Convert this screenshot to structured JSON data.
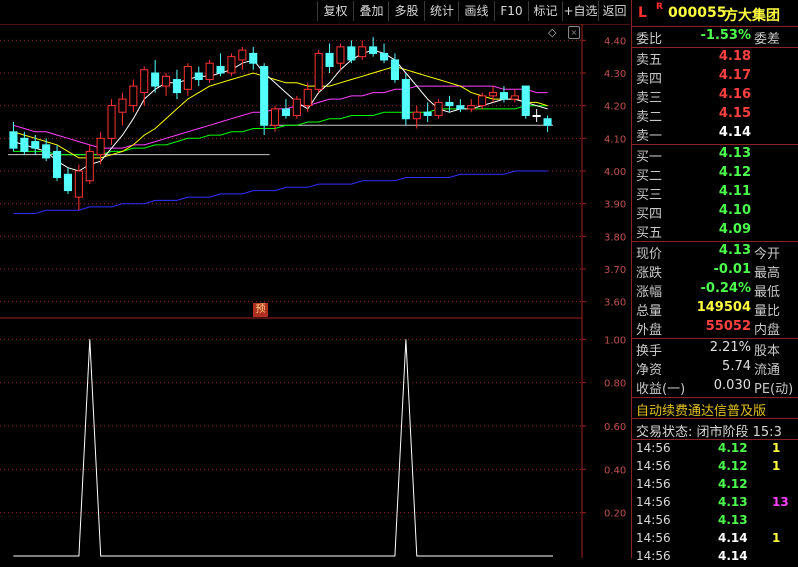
{
  "toolbar": [
    {
      "label": "复权"
    },
    {
      "label": "叠加"
    },
    {
      "label": "多股"
    },
    {
      "label": "统计"
    },
    {
      "label": "画线"
    },
    {
      "label": "F10"
    },
    {
      "label": "标记"
    },
    {
      "label": "+自选"
    },
    {
      "label": "返回"
    }
  ],
  "main_axis": [
    "4.40",
    "4.30",
    "4.20",
    "4.10",
    "4.00",
    "3.90",
    "3.80",
    "3.70",
    "3.60"
  ],
  "indicator_axis": [
    "1.00",
    "0.80",
    "0.60",
    "0.40",
    "0.20"
  ],
  "pre_badge": "预",
  "colors": {
    "up": "#ff3333",
    "down": "#54ffff",
    "flat": "#ffffff",
    "ma5": "#ffffff",
    "ma10": "#ffff00",
    "ma20": "#ff40ff",
    "ma60": "#00ff00",
    "ma120": "#3030ff",
    "line_flat": "#c8c8c8"
  },
  "chart_data": {
    "type": "candlestick",
    "ylim": [
      3.55,
      4.45
    ],
    "candles": [
      {
        "o": 4.12,
        "h": 4.15,
        "l": 4.06,
        "c": 4.07
      },
      {
        "o": 4.1,
        "h": 4.12,
        "l": 4.05,
        "c": 4.06
      },
      {
        "o": 4.09,
        "h": 4.11,
        "l": 4.05,
        "c": 4.07
      },
      {
        "o": 4.08,
        "h": 4.1,
        "l": 4.03,
        "c": 4.04
      },
      {
        "o": 4.06,
        "h": 4.08,
        "l": 3.97,
        "c": 3.98
      },
      {
        "o": 3.99,
        "h": 4.01,
        "l": 3.93,
        "c": 3.94
      },
      {
        "o": 3.92,
        "h": 4.02,
        "l": 3.88,
        "c": 4.0
      },
      {
        "o": 3.97,
        "h": 4.08,
        "l": 3.96,
        "c": 4.06
      },
      {
        "o": 4.05,
        "h": 4.12,
        "l": 4.02,
        "c": 4.1
      },
      {
        "o": 4.1,
        "h": 4.22,
        "l": 4.08,
        "c": 4.2
      },
      {
        "o": 4.18,
        "h": 4.24,
        "l": 4.14,
        "c": 4.22
      },
      {
        "o": 4.2,
        "h": 4.28,
        "l": 4.18,
        "c": 4.26
      },
      {
        "o": 4.24,
        "h": 4.32,
        "l": 4.2,
        "c": 4.31
      },
      {
        "o": 4.3,
        "h": 4.34,
        "l": 4.24,
        "c": 4.26
      },
      {
        "o": 4.26,
        "h": 4.3,
        "l": 4.23,
        "c": 4.29
      },
      {
        "o": 4.28,
        "h": 4.31,
        "l": 4.22,
        "c": 4.24
      },
      {
        "o": 4.25,
        "h": 4.33,
        "l": 4.23,
        "c": 4.32
      },
      {
        "o": 4.3,
        "h": 4.32,
        "l": 4.26,
        "c": 4.28
      },
      {
        "o": 4.28,
        "h": 4.34,
        "l": 4.27,
        "c": 4.33
      },
      {
        "o": 4.32,
        "h": 4.36,
        "l": 4.29,
        "c": 4.3
      },
      {
        "o": 4.3,
        "h": 4.36,
        "l": 4.29,
        "c": 4.35
      },
      {
        "o": 4.34,
        "h": 4.38,
        "l": 4.31,
        "c": 4.37
      },
      {
        "o": 4.36,
        "h": 4.38,
        "l": 4.31,
        "c": 4.33
      },
      {
        "o": 4.32,
        "h": 4.33,
        "l": 4.11,
        "c": 4.14
      },
      {
        "o": 4.14,
        "h": 4.2,
        "l": 4.12,
        "c": 4.19
      },
      {
        "o": 4.19,
        "h": 4.22,
        "l": 4.16,
        "c": 4.17
      },
      {
        "o": 4.17,
        "h": 4.23,
        "l": 4.16,
        "c": 4.22
      },
      {
        "o": 4.2,
        "h": 4.27,
        "l": 4.18,
        "c": 4.25
      },
      {
        "o": 4.25,
        "h": 4.37,
        "l": 4.24,
        "c": 4.36
      },
      {
        "o": 4.36,
        "h": 4.39,
        "l": 4.3,
        "c": 4.32
      },
      {
        "o": 4.33,
        "h": 4.39,
        "l": 4.31,
        "c": 4.38
      },
      {
        "o": 4.38,
        "h": 4.4,
        "l": 4.33,
        "c": 4.34
      },
      {
        "o": 4.35,
        "h": 4.4,
        "l": 4.34,
        "c": 4.38
      },
      {
        "o": 4.38,
        "h": 4.41,
        "l": 4.35,
        "c": 4.36
      },
      {
        "o": 4.36,
        "h": 4.39,
        "l": 4.33,
        "c": 4.34
      },
      {
        "o": 4.34,
        "h": 4.36,
        "l": 4.27,
        "c": 4.28
      },
      {
        "o": 4.28,
        "h": 4.3,
        "l": 4.14,
        "c": 4.16
      },
      {
        "o": 4.16,
        "h": 4.2,
        "l": 4.13,
        "c": 4.18
      },
      {
        "o": 4.18,
        "h": 4.21,
        "l": 4.15,
        "c": 4.17
      },
      {
        "o": 4.17,
        "h": 4.22,
        "l": 4.16,
        "c": 4.21
      },
      {
        "o": 4.21,
        "h": 4.23,
        "l": 4.18,
        "c": 4.2
      },
      {
        "o": 4.2,
        "h": 4.22,
        "l": 4.18,
        "c": 4.19
      },
      {
        "o": 4.19,
        "h": 4.22,
        "l": 4.18,
        "c": 4.2
      },
      {
        "o": 4.2,
        "h": 4.24,
        "l": 4.19,
        "c": 4.23
      },
      {
        "o": 4.23,
        "h": 4.26,
        "l": 4.21,
        "c": 4.24
      },
      {
        "o": 4.24,
        "h": 4.26,
        "l": 4.21,
        "c": 4.22
      },
      {
        "o": 4.22,
        "h": 4.25,
        "l": 4.21,
        "c": 4.23
      },
      {
        "o": 4.26,
        "h": 4.26,
        "l": 4.16,
        "c": 4.17
      },
      {
        "o": 4.17,
        "h": 4.19,
        "l": 4.15,
        "c": 4.17
      },
      {
        "o": 4.16,
        "h": 4.17,
        "l": 4.12,
        "c": 4.14
      }
    ],
    "ma5": [
      4.09,
      4.08,
      4.07,
      4.06,
      4.03,
      4.01,
      4.0,
      4.02,
      4.03,
      4.07,
      4.11,
      4.16,
      4.22,
      4.25,
      4.27,
      4.27,
      4.28,
      4.29,
      4.29,
      4.3,
      4.31,
      4.33,
      4.34,
      4.3,
      4.27,
      4.24,
      4.21,
      4.19,
      4.24,
      4.27,
      4.31,
      4.34,
      4.36,
      4.37,
      4.36,
      4.34,
      4.3,
      4.26,
      4.22,
      4.19,
      4.18,
      4.19,
      4.19,
      4.2,
      4.21,
      4.22,
      4.22,
      4.21,
      4.2,
      4.19
    ],
    "ma10": [
      4.12,
      4.11,
      4.1,
      4.09,
      4.08,
      4.06,
      4.04,
      4.04,
      4.04,
      4.05,
      4.06,
      4.08,
      4.11,
      4.13,
      4.16,
      4.19,
      4.22,
      4.24,
      4.26,
      4.27,
      4.28,
      4.29,
      4.3,
      4.29,
      4.28,
      4.27,
      4.27,
      4.26,
      4.26,
      4.26,
      4.27,
      4.28,
      4.29,
      4.3,
      4.31,
      4.32,
      4.31,
      4.3,
      4.29,
      4.28,
      4.27,
      4.26,
      4.24,
      4.23,
      4.22,
      4.22,
      4.22,
      4.21,
      4.21,
      4.2
    ],
    "ma20": [
      4.14,
      4.13,
      4.12,
      4.12,
      4.11,
      4.1,
      4.09,
      4.08,
      4.07,
      4.07,
      4.07,
      4.08,
      4.08,
      4.09,
      4.1,
      4.11,
      4.12,
      4.13,
      4.14,
      4.15,
      4.16,
      4.17,
      4.18,
      4.18,
      4.19,
      4.19,
      4.2,
      4.2,
      4.21,
      4.22,
      4.22,
      4.23,
      4.23,
      4.24,
      4.24,
      4.25,
      4.25,
      4.26,
      4.26,
      4.26,
      4.26,
      4.26,
      4.26,
      4.26,
      4.26,
      4.25,
      4.25,
      4.25,
      4.24,
      4.24
    ],
    "ma60": [
      4.06,
      4.06,
      4.06,
      4.06,
      4.05,
      4.05,
      4.05,
      4.05,
      4.05,
      4.06,
      4.06,
      4.07,
      4.07,
      4.08,
      4.08,
      4.09,
      4.1,
      4.1,
      4.11,
      4.11,
      4.12,
      4.12,
      4.13,
      4.13,
      4.13,
      4.14,
      4.14,
      4.15,
      4.15,
      4.16,
      4.16,
      4.17,
      4.17,
      4.17,
      4.18,
      4.18,
      4.18,
      4.18,
      4.18,
      4.19,
      4.19,
      4.19,
      4.19,
      4.19,
      4.19,
      4.19,
      4.19,
      4.2,
      4.2,
      4.2
    ],
    "ma120": [
      3.87,
      3.87,
      3.87,
      3.88,
      3.88,
      3.88,
      3.88,
      3.89,
      3.89,
      3.89,
      3.9,
      3.9,
      3.9,
      3.91,
      3.91,
      3.91,
      3.92,
      3.92,
      3.92,
      3.93,
      3.93,
      3.93,
      3.94,
      3.94,
      3.94,
      3.95,
      3.95,
      3.95,
      3.96,
      3.96,
      3.96,
      3.96,
      3.97,
      3.97,
      3.97,
      3.97,
      3.98,
      3.98,
      3.98,
      3.98,
      3.98,
      3.99,
      3.99,
      3.99,
      3.99,
      3.99,
      4.0,
      4.0,
      4.0,
      4.0
    ],
    "flat_line": [
      {
        "from": 0,
        "to": 24,
        "v": 4.05
      },
      {
        "from": 24,
        "to": 50,
        "v": 4.14
      }
    ],
    "indicator": {
      "ylim": [
        0,
        1.08
      ],
      "x": [
        0,
        6,
        7,
        8,
        35,
        36,
        37,
        50
      ],
      "y": [
        0,
        0,
        1,
        0,
        0,
        1,
        0,
        0
      ]
    }
  },
  "stock": {
    "mark_l": "L",
    "mark_r": "R",
    "code": "000055",
    "name": "方大集团"
  },
  "weibi": {
    "label": "委比",
    "value": "-1.53%",
    "right": "委差"
  },
  "asks": [
    {
      "label": "卖五",
      "price": "4.18"
    },
    {
      "label": "卖四",
      "price": "4.17"
    },
    {
      "label": "卖三",
      "price": "4.16"
    },
    {
      "label": "卖二",
      "price": "4.15"
    },
    {
      "label": "卖一",
      "price": "4.14"
    }
  ],
  "bids": [
    {
      "label": "买一",
      "price": "4.13"
    },
    {
      "label": "买二",
      "price": "4.12"
    },
    {
      "label": "买三",
      "price": "4.11"
    },
    {
      "label": "买四",
      "price": "4.10"
    },
    {
      "label": "买五",
      "price": "4.09"
    }
  ],
  "quote": [
    {
      "label": "现价",
      "value": "4.13",
      "right": "今开",
      "color": "#4cff4c"
    },
    {
      "label": "涨跌",
      "value": "-0.01",
      "right": "最高",
      "color": "#4cff4c"
    },
    {
      "label": "涨幅",
      "value": "-0.24%",
      "right": "最低",
      "color": "#4cff4c"
    },
    {
      "label": "总量",
      "value": "149504",
      "right": "量比",
      "color": "#ffff40"
    },
    {
      "label": "外盘",
      "value": "55052",
      "right": "内盘",
      "color": "#ff4040"
    }
  ],
  "fund": [
    {
      "label": "换手",
      "value": "2.21%",
      "right": "股本"
    },
    {
      "label": "净资",
      "value": "5.74",
      "right": "流通"
    },
    {
      "label": "收益(一)",
      "value": "0.030",
      "right": "PE(动)"
    }
  ],
  "banner": "自动续费通达信普及版",
  "trade_status": "交易状态: 闭市阶段 15:3",
  "ticks": [
    {
      "time": "14:56",
      "price": "4.12",
      "vol": "1",
      "pc": "#4cff4c",
      "vc": "#ffff40"
    },
    {
      "time": "14:56",
      "price": "4.12",
      "vol": "1",
      "pc": "#4cff4c",
      "vc": "#ffff40"
    },
    {
      "time": "14:56",
      "price": "4.12",
      "vol": "",
      "pc": "#4cff4c",
      "vc": "#ffff40"
    },
    {
      "time": "14:56",
      "price": "4.13",
      "vol": "13",
      "pc": "#4cff4c",
      "vc": "#ff40ff"
    },
    {
      "time": "14:56",
      "price": "4.13",
      "vol": "",
      "pc": "#4cff4c",
      "vc": "#ffff40"
    },
    {
      "time": "14:56",
      "price": "4.14",
      "vol": "1",
      "pc": "#ffffff",
      "vc": "#ffff40"
    },
    {
      "time": "14:56",
      "price": "4.14",
      "vol": "",
      "pc": "#ffffff",
      "vc": "#ffff40"
    }
  ]
}
